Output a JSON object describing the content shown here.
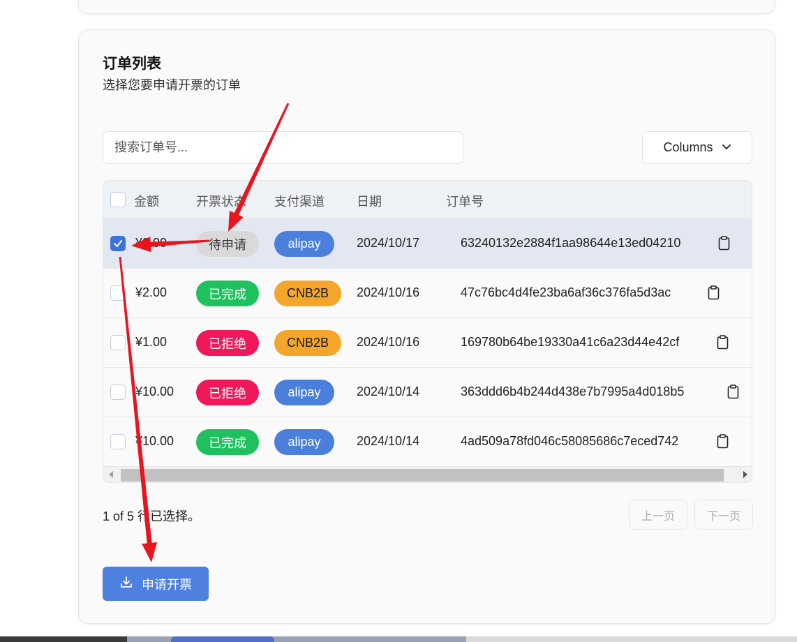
{
  "panel": {
    "title": "订单列表",
    "subtitle": "选择您要申请开票的订单"
  },
  "search": {
    "placeholder": "搜索订单号..."
  },
  "columns_button": {
    "label": "Columns",
    "icon": "chevron-down-icon"
  },
  "table": {
    "headers": {
      "amount": "金额",
      "status": "开票状态",
      "channel": "支付渠道",
      "date": "日期",
      "order": "订单号"
    },
    "rows": [
      {
        "selected": true,
        "amount": "¥0.00",
        "status": "待申请",
        "channel": "alipay",
        "date": "2024/10/17",
        "order": "63240132e2884f1aa98644e13ed04210"
      },
      {
        "selected": false,
        "amount": "¥2.00",
        "status": "已完成",
        "channel": "CNB2B",
        "date": "2024/10/16",
        "order": "47c76bc4d4fe23ba6af36c376fa5d3ac"
      },
      {
        "selected": false,
        "amount": "¥1.00",
        "status": "已拒绝",
        "channel": "CNB2B",
        "date": "2024/10/16",
        "order": "169780b64be19330a41c6a23d44e42cf"
      },
      {
        "selected": false,
        "amount": "¥10.00",
        "status": "已拒绝",
        "channel": "alipay",
        "date": "2024/10/14",
        "order": "363ddd6b4b244d438e7b7995a4d018b5"
      },
      {
        "selected": false,
        "amount": "¥10.00",
        "status": "已完成",
        "channel": "alipay",
        "date": "2024/10/14",
        "order": "4ad509a78fd046c58085686c7eced742"
      }
    ]
  },
  "status_colors": {
    "待申请": {
      "bg": "#d9d9d9",
      "fg": "#333333"
    },
    "已完成": {
      "bg": "#1fc15f",
      "fg": "#ffffff"
    },
    "已拒绝": {
      "bg": "#f0185b",
      "fg": "#ffffff"
    }
  },
  "channel_colors": {
    "alipay": {
      "bg": "#4a7fdc",
      "fg": "#ffffff"
    },
    "CNB2B": {
      "bg": "#f4a62a",
      "fg": "#1a1a1a"
    }
  },
  "footer": {
    "selection_info": "1 of 5 行已选择。",
    "prev_label": "上一页",
    "next_label": "下一页"
  },
  "apply_button": {
    "label": "申请开票",
    "icon": "download-icon"
  },
  "annotation_color": "#e8141e"
}
